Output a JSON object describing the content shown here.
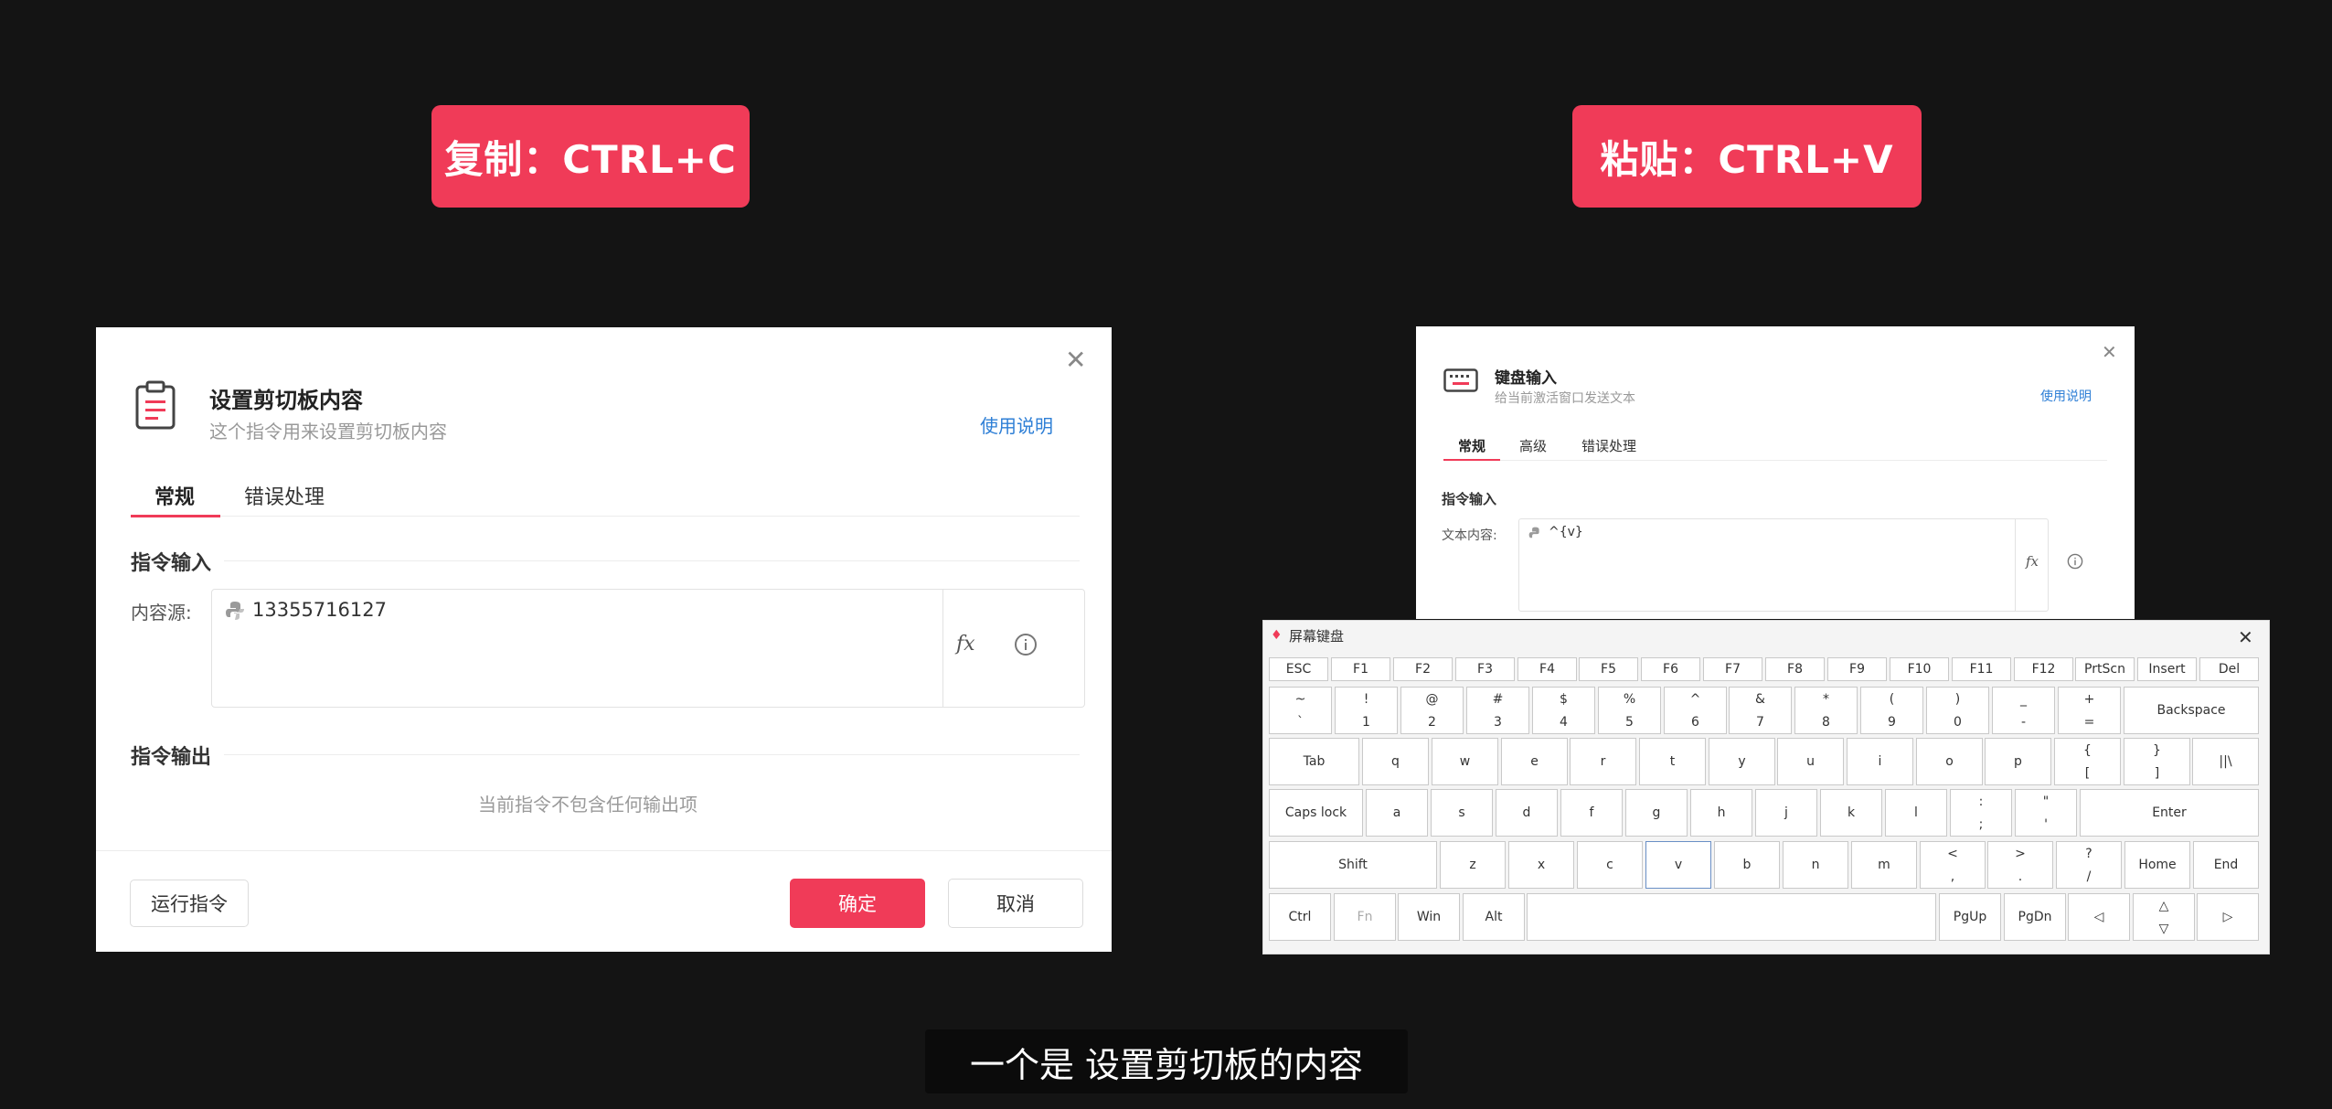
{
  "badges": {
    "copy": "复制：CTRL+C",
    "paste": "粘贴：CTRL+V"
  },
  "left_dialog": {
    "title": "设置剪切板内容",
    "subtitle": "这个指令用来设置剪切板内容",
    "help_link": "使用说明",
    "close_icon": "close-icon",
    "tabs": [
      {
        "label": "常规",
        "active": true
      },
      {
        "label": "错误处理",
        "active": false
      }
    ],
    "input_section": "指令输入",
    "content_label": "内容源:",
    "content_value": "13355716127",
    "fx_label": "fx",
    "output_section": "指令输出",
    "output_empty": "当前指令不包含任何输出项",
    "run_button": "运行指令",
    "ok_button": "确定",
    "cancel_button": "取消"
  },
  "right_dialog": {
    "title": "键盘输入",
    "subtitle": "给当前激活窗口发送文本",
    "help_link": "使用说明",
    "tabs": [
      {
        "label": "常规",
        "active": true
      },
      {
        "label": "高级",
        "active": false
      },
      {
        "label": "错误处理",
        "active": false
      }
    ],
    "input_section": "指令输入",
    "text_label": "文本内容:",
    "text_value": "^{v}",
    "fx_label": "fx"
  },
  "keyboard": {
    "title": "屏幕键盘",
    "rows": [
      [
        "ESC",
        "F1",
        "F2",
        "F3",
        "F4",
        "F5",
        "F6",
        "F7",
        "F8",
        "F9",
        "F10",
        "F11",
        "F12",
        "PrtScn",
        "Insert",
        "Del"
      ],
      [
        "~|`",
        "!|1",
        "@|2",
        "#|3",
        "$|4",
        "%|5",
        "^|6",
        "&|7",
        "*|8",
        "(|9",
        ")|0",
        "_|-",
        "+|=",
        "Backspace"
      ],
      [
        "Tab",
        "q",
        "w",
        "e",
        "r",
        "t",
        "y",
        "u",
        "i",
        "o",
        "p",
        "{|[",
        "}|]",
        "||\\"
      ],
      [
        "Caps lock",
        "a",
        "s",
        "d",
        "f",
        "g",
        "h",
        "j",
        "k",
        "l",
        ":|;",
        "\"|'",
        "Enter"
      ],
      [
        "Shift",
        "z",
        "x",
        "c",
        "v",
        "b",
        "n",
        "m",
        "<|,",
        ">|.",
        "?|/",
        "Home",
        "End"
      ],
      [
        "Ctrl",
        "Fn",
        "Win",
        "Alt",
        "",
        "PgUp",
        "PgDn",
        "◁",
        "△|▽",
        "▷"
      ]
    ],
    "selected_key": "v"
  },
  "caption": "一个是 设置剪切板的内容",
  "colors": {
    "accent": "#f03b58",
    "link": "#2e7fd6",
    "background": "#141414"
  }
}
